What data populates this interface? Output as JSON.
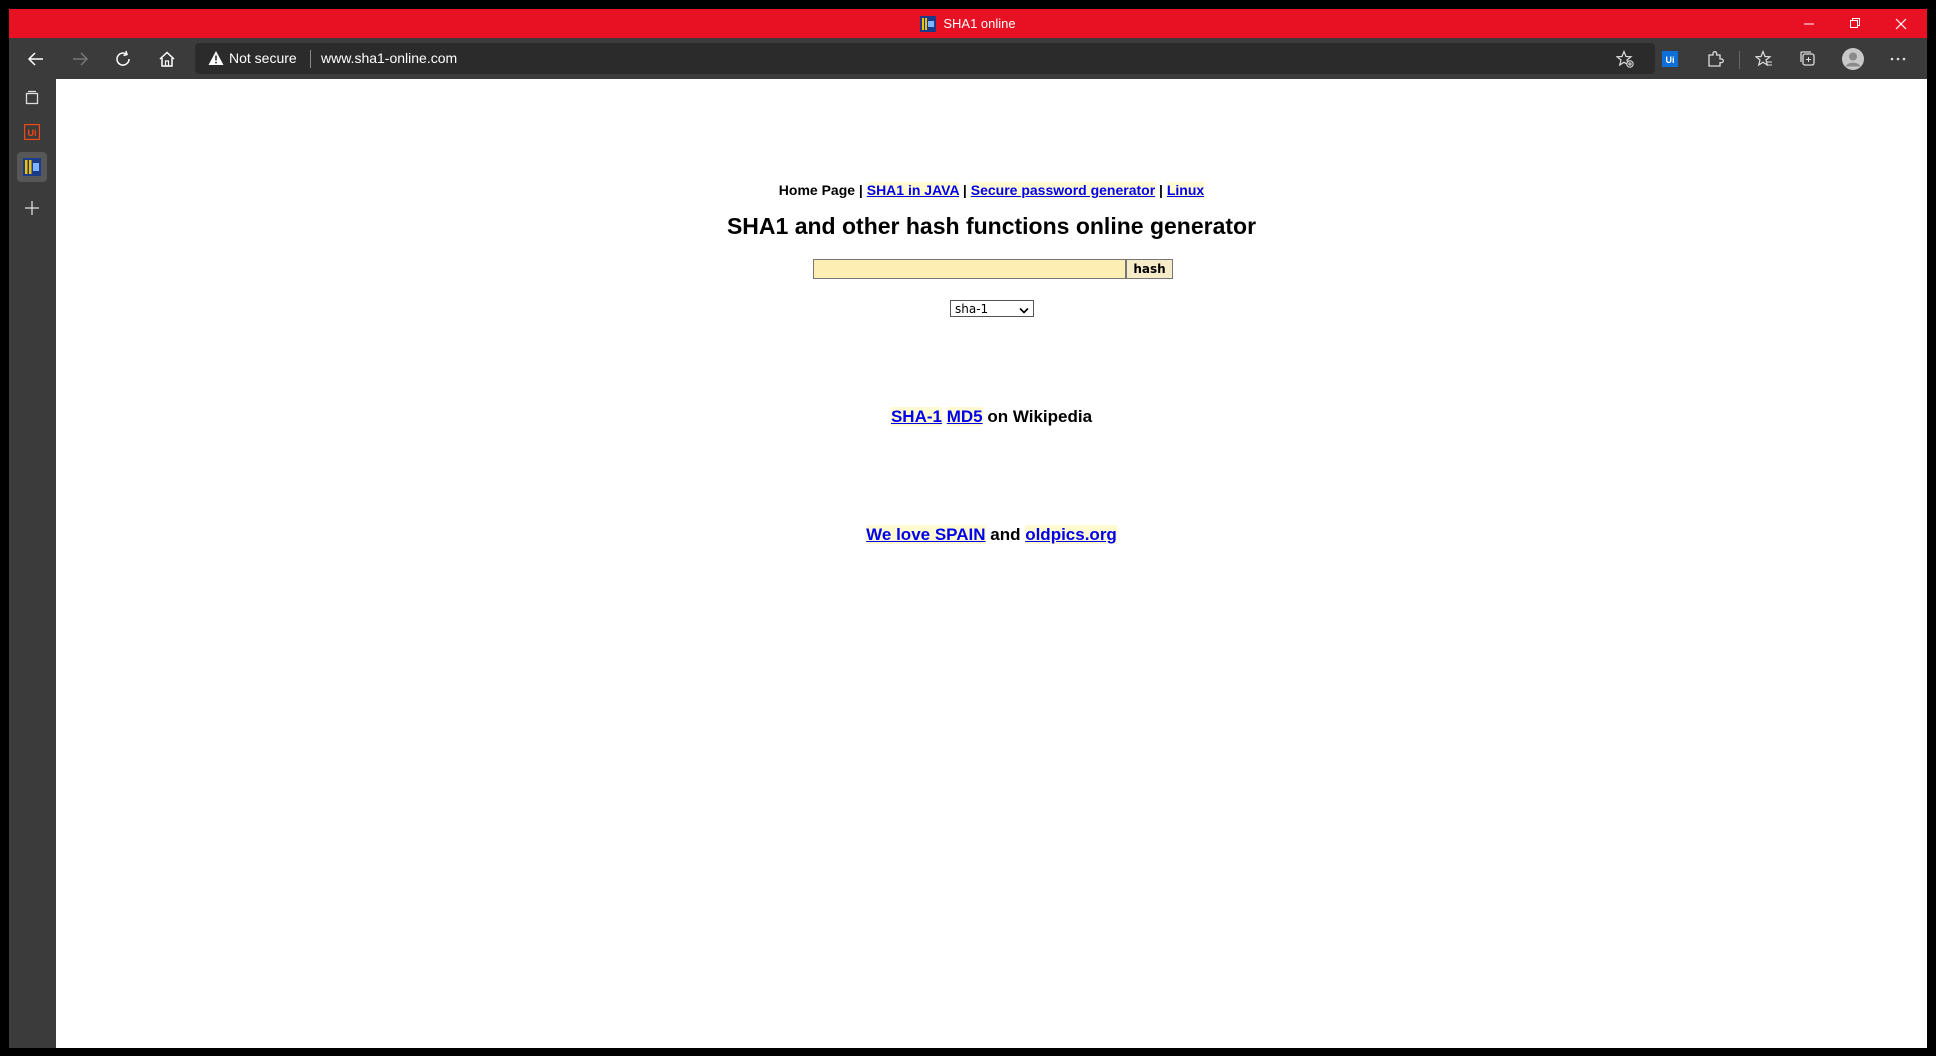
{
  "window": {
    "title": "SHA1 online",
    "accent_color": "#e81123",
    "controls": [
      "minimize-icon",
      "restore-icon",
      "close-icon"
    ]
  },
  "toolbar": {
    "security_label": "Not secure",
    "url": "www.sha1-online.com",
    "icons": [
      "back-icon",
      "forward-icon",
      "refresh-icon",
      "home-icon",
      "add-favorite-icon",
      "extension-ui-icon",
      "extensions-puzzle-icon",
      "favorites-icon",
      "collections-icon",
      "profile-icon",
      "more-icon"
    ]
  },
  "sidebar": {
    "icons": [
      "tab-actions-icon",
      "ui-app-icon",
      "sha1-tab-icon",
      "add-icon"
    ]
  },
  "page": {
    "nav": {
      "home": "Home Page",
      "sep": " | ",
      "link1": "SHA1 in JAVA",
      "link2": "Secure password generator",
      "link3": "Linux"
    },
    "heading": "SHA1 and other hash functions online generator",
    "input_value": "",
    "hash_button": "hash",
    "algorithm_selected": "sha-1",
    "wiki": {
      "link1": "SHA-1",
      "link2": "MD5",
      "suffix": " on Wikipedia"
    },
    "love": {
      "link1": "We love SPAIN",
      "middle": " and ",
      "link2": "oldpics.org"
    }
  }
}
